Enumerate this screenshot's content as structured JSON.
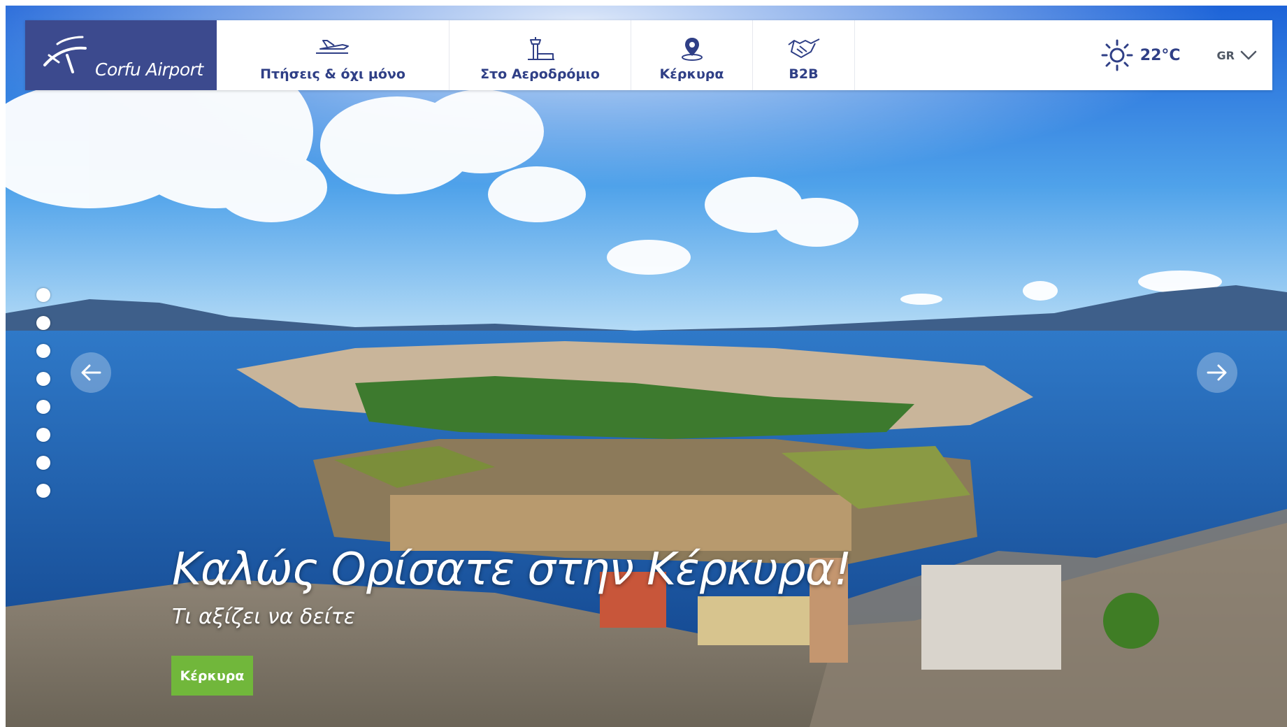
{
  "brand": {
    "name": "Corfu Airport"
  },
  "nav": {
    "items": [
      {
        "label": "Πτήσεις & όχι μόνο",
        "icon": "airplane-icon"
      },
      {
        "label": "Στο Αεροδρόμιο",
        "icon": "control-tower-icon"
      },
      {
        "label": "Κέρκυρα",
        "icon": "map-pin-icon"
      },
      {
        "label": "B2B",
        "icon": "handshake-icon"
      }
    ]
  },
  "weather": {
    "temperature": "22°C",
    "icon": "sun-icon"
  },
  "language": {
    "current": "GR",
    "icon": "chevron-down-icon"
  },
  "slider": {
    "slide_count": 8,
    "active_index": 0,
    "prev_icon": "arrow-left-icon",
    "next_icon": "arrow-right-icon"
  },
  "hero": {
    "headline": "Καλώς Ορίσατε στην Κέρκυρα!",
    "subheadline": "Τι αξίζει να δείτε",
    "button_label": "Κέρκυρα",
    "button_color": "#71b73b"
  },
  "colors": {
    "brand_navy": "#3c4a8e",
    "nav_text": "#2f3f86",
    "cta_green": "#71b73b"
  }
}
